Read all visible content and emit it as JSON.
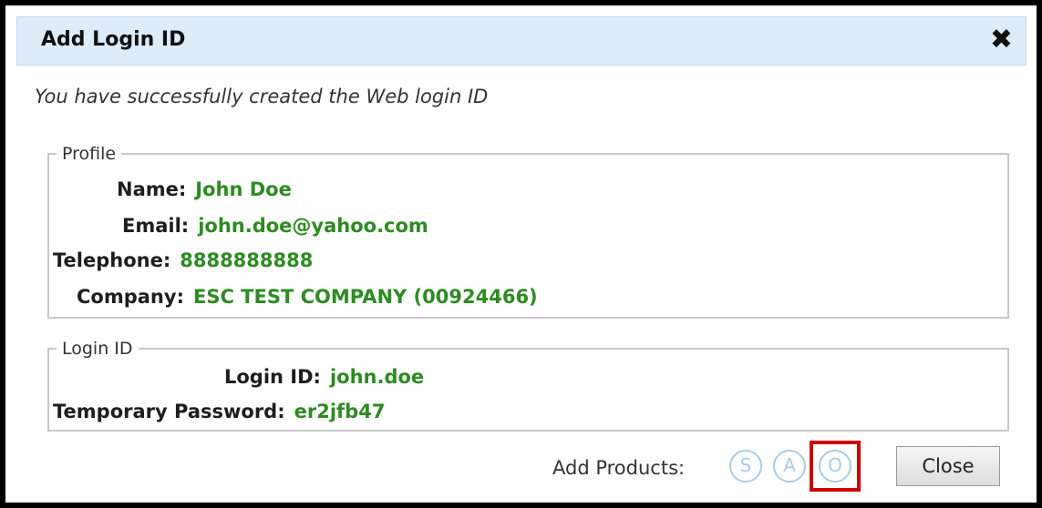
{
  "dialog": {
    "title": "Add Login ID",
    "close_glyph": "✖",
    "message": "You have successfully created the Web login ID"
  },
  "profile": {
    "legend": "Profile",
    "name_label": "Name:",
    "name_value": "John Doe",
    "email_label": "Email:",
    "email_value": "john.doe@yahoo.com",
    "telephone_label": "Telephone:",
    "telephone_value": "8888888888",
    "company_label": "Company:",
    "company_value": "ESC TEST COMPANY (00924466)"
  },
  "login": {
    "legend": "Login ID",
    "login_id_label": "Login ID:",
    "login_id_value": "john.doe",
    "password_label": "Temporary Password:",
    "password_value": "er2jfb47"
  },
  "footer": {
    "add_products_label": "Add Products:",
    "products": [
      {
        "letter": "S",
        "icon": "product-s-icon"
      },
      {
        "letter": "A",
        "icon": "product-a-icon"
      },
      {
        "letter": "O",
        "icon": "product-o-icon",
        "highlighted": true
      }
    ],
    "close_button": "Close"
  },
  "colors": {
    "title_bar": "#dcecf9",
    "value_text": "#2e8b22",
    "product_icon": "#a9cce8",
    "highlight": "#d00000"
  }
}
